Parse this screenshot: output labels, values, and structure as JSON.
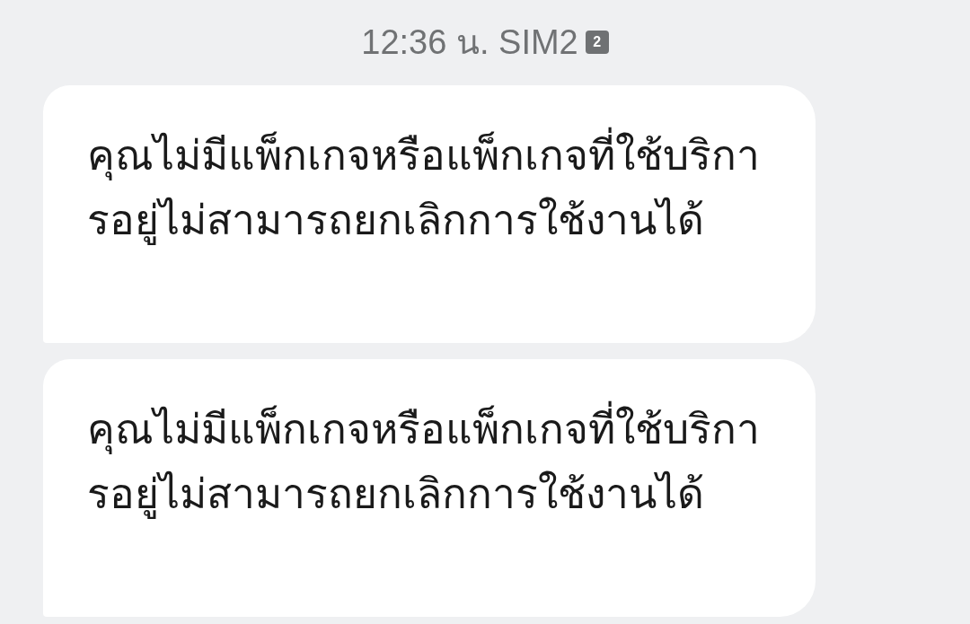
{
  "header": {
    "time": "12:36 น. SIM2",
    "sim_badge": "2"
  },
  "messages": [
    {
      "text": "คุณไม่มีแพ็กเกจหรือแพ็กเกจที่ใช้บริการอยู่ไม่สามารถยกเลิกการใช้งานได้"
    },
    {
      "text": "คุณไม่มีแพ็กเกจหรือแพ็กเกจที่ใช้บริการอยู่ไม่สามารถยกเลิกการใช้งานได้"
    }
  ]
}
